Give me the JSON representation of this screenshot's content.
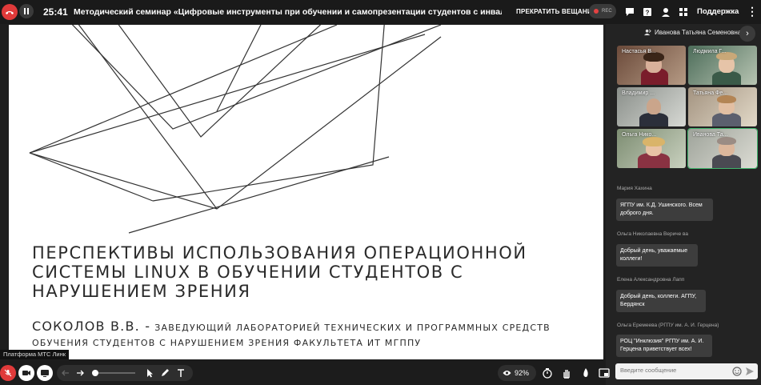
{
  "topbar": {
    "timer": "25:41",
    "title": "Методический семинар «Цифровые инструменты при обучении и самопрезентации студентов с инвалидностью",
    "stop_stream_label": "ПРЕКРАТИТЬ ВЕЩАНИЕ",
    "rec_label": "REC",
    "support_label": "Поддержка",
    "more_label": "⋮"
  },
  "slide": {
    "title": "ПЕРСПЕКТИВЫ ИСПОЛЬЗОВАНИЯ ОПЕРАЦИОННОЙ СИСТЕМЫ LINUX В ОБУЧЕНИИ СТУДЕНТОВ С НАРУШЕНИЕМ ЗРЕНИЯ",
    "author_name": "СОКОЛОВ В.В. -",
    "author_desc": "ЗАВЕДУЮЩИЙ ЛАБОРАТОРИЕЙ ТЕХНИЧЕСКИХ И ПРОГРАММНЫХ СРЕДСТВ ОБУЧЕНИЯ СТУДЕНТОВ С НАРУШЕНИЕМ ЗРЕНИЯ ФАКУЛЬТЕТА ИТ МГППУ"
  },
  "panel": {
    "presenter_name": "Иванова Татьяна Семеновна",
    "next_label": "›",
    "participants": [
      {
        "label": "Настасья В..."
      },
      {
        "label": "Людмила Г..."
      },
      {
        "label": "Владимир ..."
      },
      {
        "label": "Татьяна Фе..."
      },
      {
        "label": "Ольга Нико..."
      },
      {
        "label": "Иванова Та..."
      }
    ],
    "messages": [
      {
        "author": "Мария Хахина",
        "text": "ЯГПУ им. К.Д. Ушинского.  Всем доброго дня."
      },
      {
        "author": "Ольга Николаевна Вериче ва",
        "text": "Добрый день, уважаемые коллеги!"
      },
      {
        "author": "Елена Александровна Лапп",
        "text": "Добрый день, коллеги. АГПУ, Бердянск"
      },
      {
        "author": "Ольга Еремеева (РГПУ им. А. И. Герцена)",
        "text": "РОЦ \"Инклюзия\" РГПУ им. А. И. Герцена приветствует всех!"
      }
    ],
    "input_placeholder": "Введите сообщение"
  },
  "bottombar": {
    "platform_label": "Платформа МТС Линк",
    "zoom": "92%"
  },
  "colors": {
    "end_call": "#e03a3a",
    "rec_dot": "#e34242",
    "panel_bg": "#232323"
  }
}
